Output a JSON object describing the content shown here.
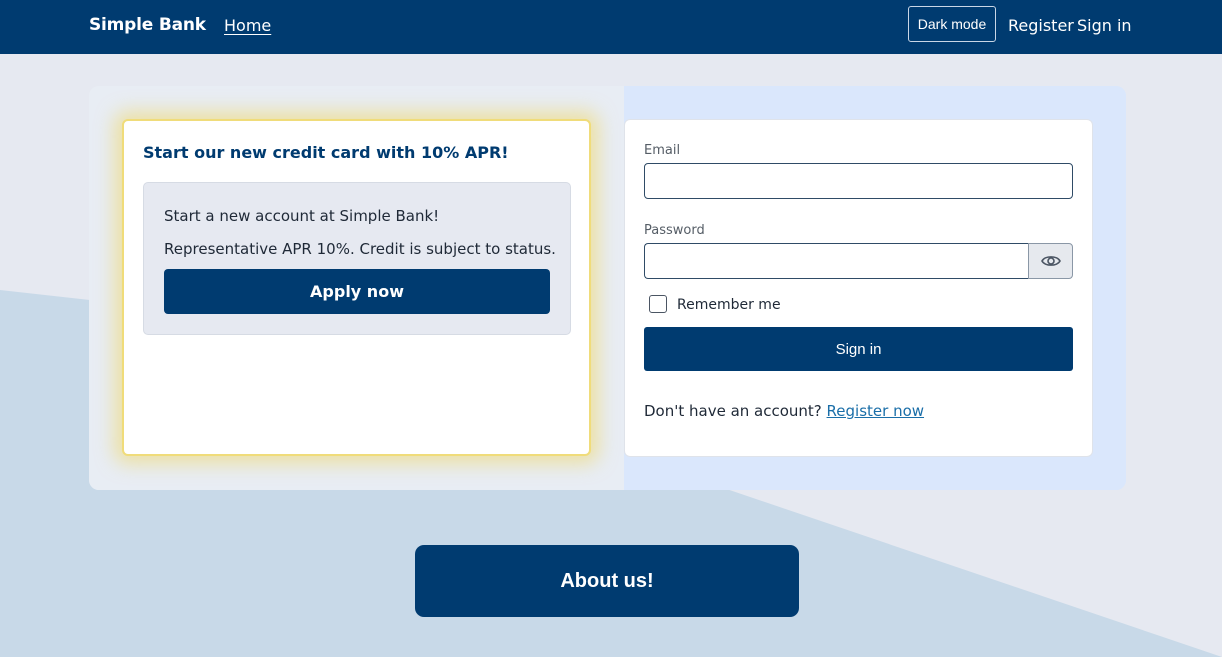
{
  "nav": {
    "brand": "Simple Bank",
    "home": "Home",
    "dark_mode": "Dark mode",
    "register": "Register",
    "sign_in": "Sign in"
  },
  "promo": {
    "title": "Start our new credit card with 10% APR!",
    "line1": "Start a new account at Simple Bank!",
    "line2": "Representative APR 10%. Credit is subject to status.",
    "apply_label": "Apply now"
  },
  "login": {
    "email_label": "Email",
    "email_value": "",
    "password_label": "Password",
    "password_value": "",
    "remember_label": "Remember me",
    "sign_in_label": "Sign in",
    "no_account_text": "Don't have an account?",
    "register_link": "Register now"
  },
  "about": {
    "label": "About us!"
  },
  "colors": {
    "primary": "#003b70",
    "promo_glow": "#f0dc7a",
    "link": "#1a6ea8",
    "page_bg": "#e6e9f1",
    "wave_bg": "#c9dae8"
  },
  "icons": {
    "password_toggle": "eye-icon"
  }
}
